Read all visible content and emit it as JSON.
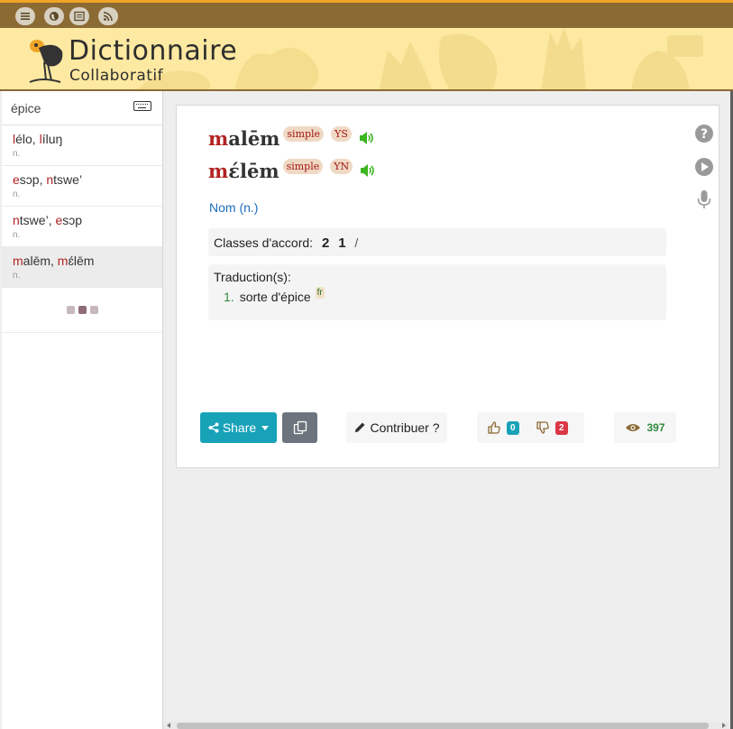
{
  "topbar": {
    "buttons": [
      "menu-icon",
      "globe-icon",
      "list-icon",
      "rss-icon"
    ]
  },
  "header": {
    "title": "Dictionnaire",
    "subtitle": "Collaboratif"
  },
  "sidebar": {
    "search_value": "épice",
    "entries": [
      {
        "parts": [
          {
            "r": "l",
            "t": "élo, "
          },
          {
            "r": "l",
            "t": "íluŋ"
          }
        ],
        "pos": "n."
      },
      {
        "parts": [
          {
            "r": "e",
            "t": "sɔp, "
          },
          {
            "r": "n",
            "t": "tswe’"
          }
        ],
        "pos": "n."
      },
      {
        "parts": [
          {
            "r": "n",
            "t": "tswe’, "
          },
          {
            "r": "e",
            "t": "sɔp"
          }
        ],
        "pos": "n."
      },
      {
        "parts": [
          {
            "r": "m",
            "t": "alēm, "
          },
          {
            "r": "m",
            "t": "ɛ́lēm"
          }
        ],
        "pos": "n."
      }
    ]
  },
  "entry": {
    "headwords": [
      {
        "first": "m",
        "rest": "alēm",
        "tag": "simple",
        "dialect": "YS"
      },
      {
        "first": "m",
        "rest": "ɛ́lēm",
        "tag": "simple",
        "dialect": "YN"
      }
    ],
    "pos_label": "Nom (n.)",
    "classes_label": "Classes d'accord:",
    "class_values": [
      "2",
      "1"
    ],
    "class_separator": "/",
    "translations_label": "Traduction(s):",
    "translations": [
      {
        "num": "1.",
        "text": "sorte d'épice",
        "lang": "fr"
      }
    ]
  },
  "actions": {
    "share_label": "Share",
    "contribute_label": "Contribuer ?",
    "upvotes": "0",
    "downvotes": "2",
    "views": "397"
  },
  "colors": {
    "brand_brown": "#8b6a33",
    "header_yellow": "#fde9a1",
    "red_letter": "#b22222",
    "share_teal": "#17a2b8"
  }
}
